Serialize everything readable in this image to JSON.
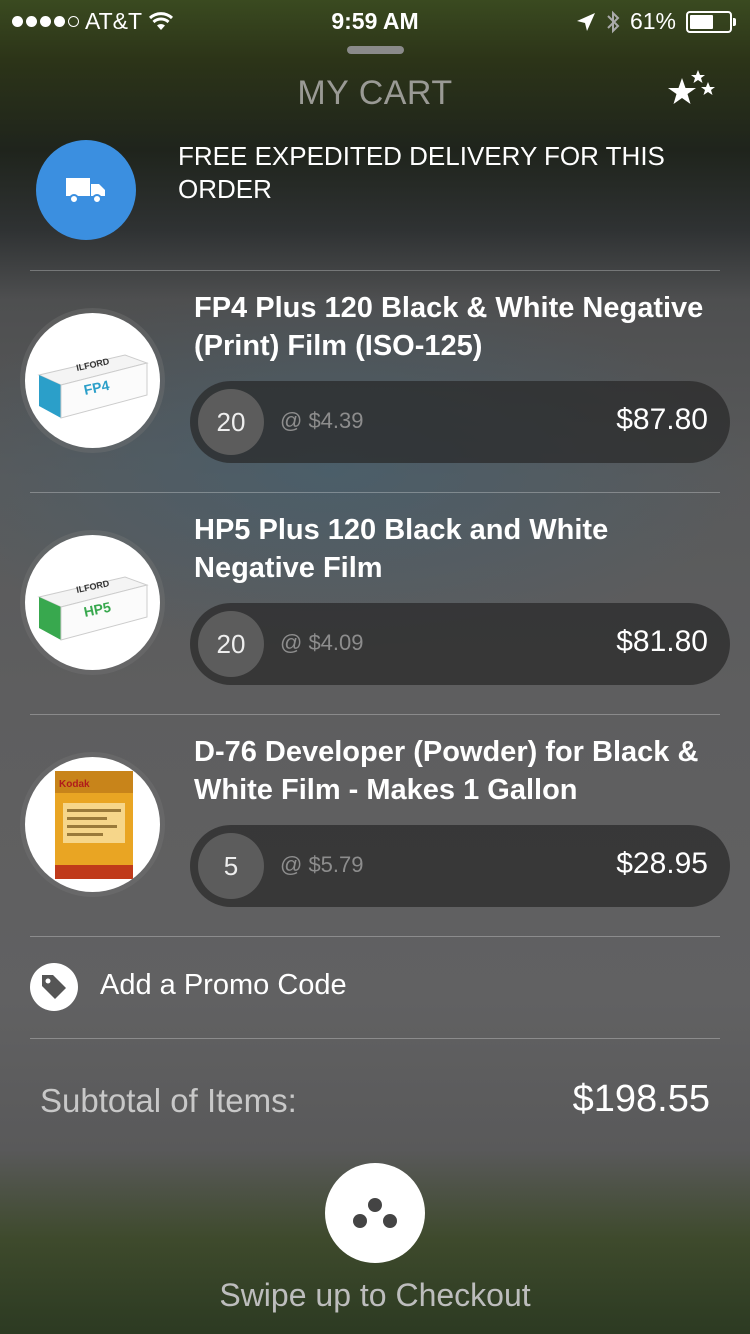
{
  "status_bar": {
    "carrier": "AT&T",
    "time": "9:59 AM",
    "battery": "61%",
    "battery_level": 0.61,
    "signal_bars_filled": 4,
    "signal_bars_total": 5
  },
  "header": {
    "title": "MY CART",
    "favorites_icon": "stars-icon"
  },
  "delivery_banner": {
    "icon": "truck-icon",
    "icon_bg": "#3b8fe0",
    "text": "FREE EXPEDITED DELIVERY FOR THIS ORDER"
  },
  "cart_items": [
    {
      "name": "FP4 Plus 120 Black & White Negative (Print) Film (ISO-125)",
      "quantity": "20",
      "unit_price": "@ $4.39",
      "total": "$87.80",
      "image": "film-box-icon"
    },
    {
      "name": "HP5 Plus 120 Black and White Negative Film",
      "quantity": "20",
      "unit_price": "@ $4.09",
      "total": "$81.80",
      "image": "film-box-icon"
    },
    {
      "name": "D-76 Developer (Powder) for Black & White Film - Makes 1 Gallon",
      "quantity": "5",
      "unit_price": "@ $5.79",
      "total": "$28.95",
      "image": "developer-pouch-icon"
    }
  ],
  "promo": {
    "label": "Add a Promo Code",
    "icon": "tag-icon"
  },
  "subtotal": {
    "label": "Subtotal of Items:",
    "value": "$198.55"
  },
  "checkout": {
    "hint": "Swipe up to Checkout",
    "icon": "dots-icon"
  }
}
